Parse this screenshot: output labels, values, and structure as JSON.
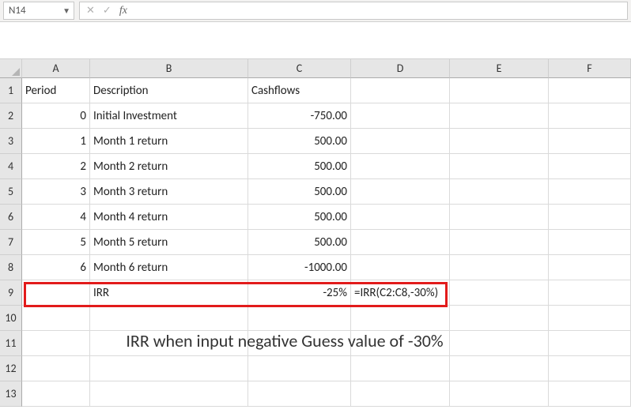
{
  "namebox": {
    "cell_ref": "N14"
  },
  "formula_bar": {
    "value": ""
  },
  "columns": [
    "A",
    "B",
    "C",
    "D",
    "E",
    "F"
  ],
  "rows": [
    "1",
    "2",
    "3",
    "4",
    "5",
    "6",
    "7",
    "8",
    "9",
    "10",
    "11",
    "12",
    "13"
  ],
  "headers": {
    "A1": "Period",
    "B1": "Description",
    "C1": "Cashflows"
  },
  "data": [
    {
      "period": "0",
      "desc": "Initial Investment",
      "cash": "-750.00"
    },
    {
      "period": "1",
      "desc": "Month 1 return",
      "cash": "500.00"
    },
    {
      "period": "2",
      "desc": "Month 2 return",
      "cash": "500.00"
    },
    {
      "period": "3",
      "desc": "Month 3 return",
      "cash": "500.00"
    },
    {
      "period": "4",
      "desc": "Month 4 return",
      "cash": "500.00"
    },
    {
      "period": "5",
      "desc": "Month 5 return",
      "cash": "500.00"
    },
    {
      "period": "6",
      "desc": "Month 6 return",
      "cash": "-1000.00"
    }
  ],
  "irr_row": {
    "label": "IRR",
    "value": "-25%",
    "formula_display": "=IRR(C2:C8,-30%)"
  },
  "caption": "IRR when input negative Guess value of -30%"
}
